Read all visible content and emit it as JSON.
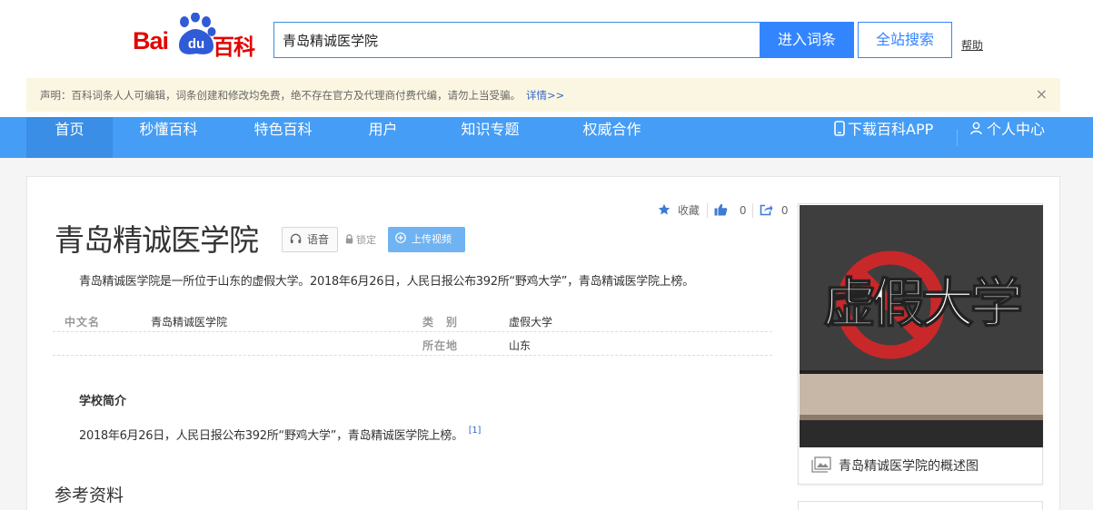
{
  "header": {
    "logo_part1": "Bai",
    "logo_part2": "du",
    "logo_part3": "百科",
    "search_value": "青岛精诚医学院",
    "enter_label": "进入词条",
    "search_all_label": "全站搜索",
    "help_label": "帮助"
  },
  "notice": {
    "text": "声明：百科词条人人可编辑，词条创建和修改均免费，绝不存在官方及代理商付费代编，请勿上当受骗。",
    "more": "详情>>",
    "close": "×"
  },
  "nav": {
    "items": [
      "首页",
      "秒懂百科",
      "特色百科",
      "用户",
      "知识专题",
      "权威合作"
    ],
    "app_label": "下载百科APP",
    "user_center_label": "个人中心"
  },
  "entry": {
    "title": "青岛精诚医学院",
    "voice_label": "语音",
    "lock_label": "锁定",
    "upload_label": "上传视频",
    "collect_label": "收藏",
    "like_count": "0",
    "share_count": "0",
    "summary": "青岛精诚医学院是一所位于山东的虚假大学。2018年6月26日，人民日报公布392所“野鸡大学”，青岛精诚医学院上榜。"
  },
  "infobox": [
    {
      "left_key": "中文名",
      "left_value": "青岛精诚医学院",
      "right_key": "类　别",
      "right_value": "虚假大学"
    },
    {
      "left_key": "",
      "left_value": "",
      "right_key": "所在地",
      "right_value": "山东"
    }
  ],
  "section": {
    "title": "学校简介",
    "body": "2018年6月26日，人民日报公布392所“野鸡大学”，青岛精诚医学院上榜。",
    "ref_mark": "[1]"
  },
  "references_title": "参考资料",
  "image_card": {
    "image_text": "虚假大学",
    "caption": "青岛精诚医学院的概述图"
  },
  "colors": {
    "brand_red": "#e10601",
    "nav_blue": "#459df5",
    "button_blue": "#3385ff"
  }
}
